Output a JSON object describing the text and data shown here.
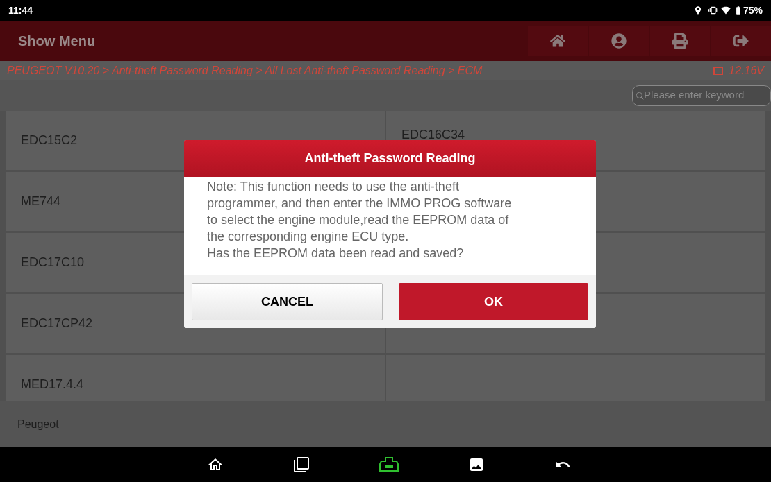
{
  "status_bar": {
    "time": "11:44",
    "battery": "75%"
  },
  "header": {
    "title": "Show Menu"
  },
  "breadcrumb": {
    "path": "PEUGEOT V10.20 > Anti-theft Password Reading > All Lost Anti-theft Password Reading > ECM",
    "voltage": "12.16V"
  },
  "search": {
    "placeholder": "Please enter keyword"
  },
  "rows": [
    {
      "cells": [
        {
          "label": "EDC15C2"
        },
        {
          "label": "EDC16C34"
        }
      ]
    },
    {
      "cells": [
        {
          "label": "ME744"
        }
      ]
    },
    {
      "cells": [
        {
          "label": "EDC17C10"
        }
      ]
    },
    {
      "cells": [
        {
          "label": "EDC17CP42"
        }
      ]
    },
    {
      "cells": [
        {
          "label": "MED17.4.4"
        }
      ]
    }
  ],
  "footer": {
    "label": "Peugeot"
  },
  "dialog": {
    "title": "Anti-theft Password Reading",
    "message": "Note: This function needs to use the anti-theft programmer, and then enter the IMMO PROG software to select the engine module,read the EEPROM data of the corresponding engine ECU type.\nHas the EEPROM data been read and saved?",
    "buttons": [
      {
        "label": "CANCEL",
        "kind": "secondary"
      },
      {
        "label": "OK",
        "kind": "primary"
      }
    ]
  }
}
